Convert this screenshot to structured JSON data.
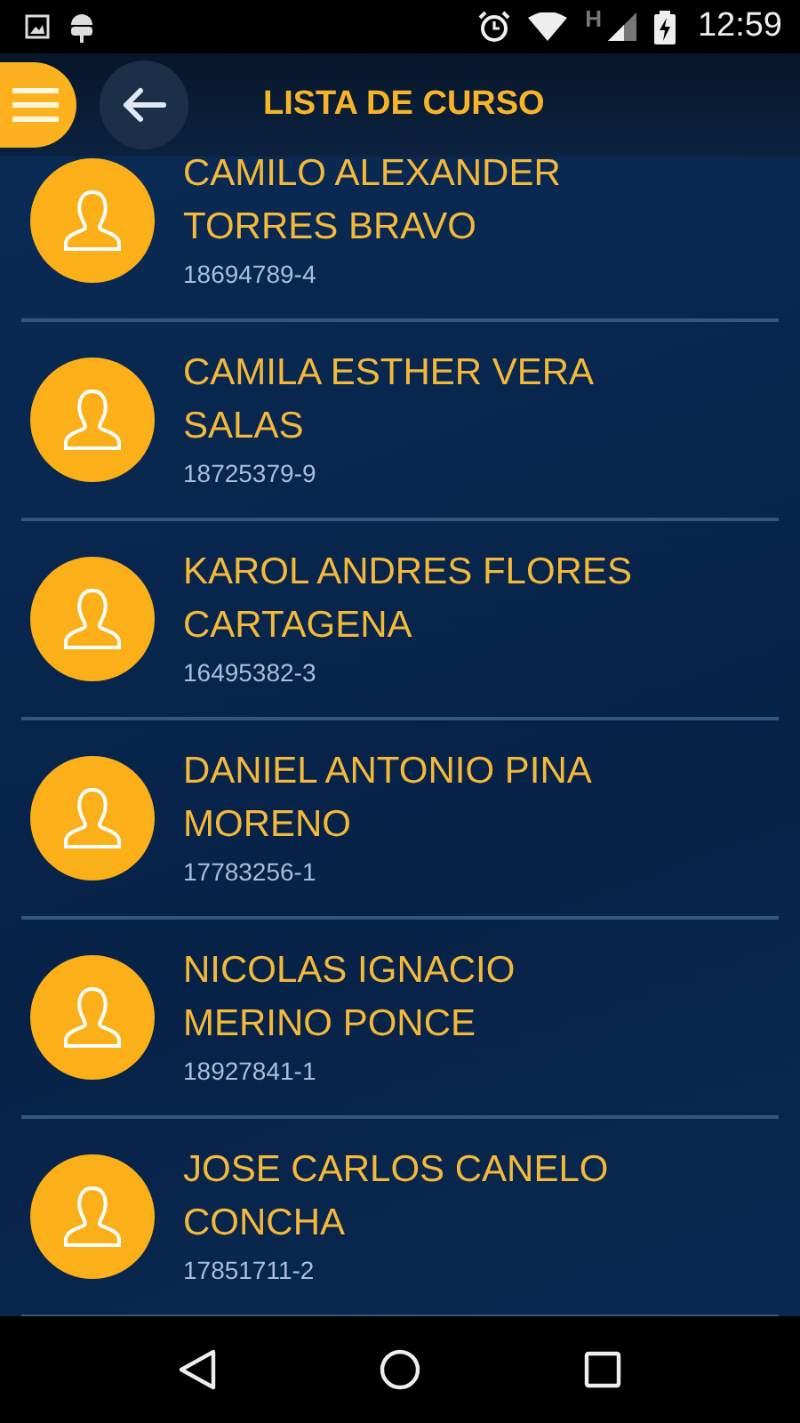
{
  "status_bar": {
    "network": "H",
    "time": "12:59"
  },
  "header": {
    "title": "LISTA DE CURSO"
  },
  "students": [
    {
      "name": "CAMILO ALEXANDER TORRES BRAVO",
      "id": "18694789-4"
    },
    {
      "name": "CAMILA ESTHER VERA SALAS",
      "id": "18725379-9"
    },
    {
      "name": "KAROL ANDRES FLORES CARTAGENA",
      "id": "16495382-3"
    },
    {
      "name": "DANIEL ANTONIO PINA MORENO",
      "id": "17783256-1"
    },
    {
      "name": "NICOLAS IGNACIO MERINO PONCE",
      "id": "18927841-1"
    },
    {
      "name": "JOSE CARLOS CANELO CONCHA",
      "id": "17851711-2"
    }
  ]
}
